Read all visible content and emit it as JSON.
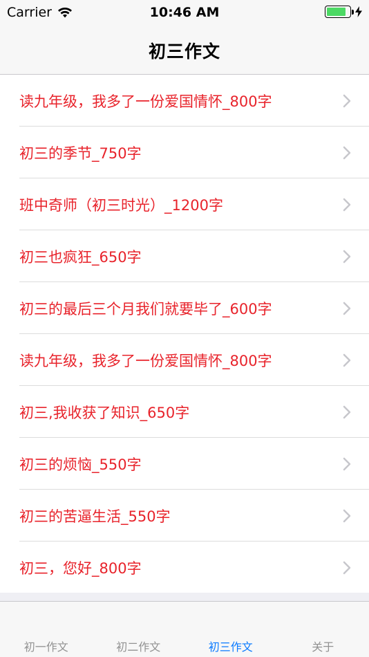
{
  "status_bar": {
    "carrier": "Carrier",
    "time": "10:46 AM",
    "battery_level": 0.85,
    "wifi_icon": "wifi-icon",
    "charging_icon": "bolt-icon"
  },
  "nav": {
    "title": "初三作文"
  },
  "list": {
    "items": [
      {
        "label": "读九年级，我多了一份爱国情怀_800字"
      },
      {
        "label": "初三的季节_750字"
      },
      {
        "label": "班中奇师（初三时光）_1200字"
      },
      {
        "label": "初三也疯狂_650字"
      },
      {
        "label": "初三的最后三个月我们就要毕了_600字"
      },
      {
        "label": "读九年级，我多了一份爱国情怀_800字"
      },
      {
        "label": "初三,我收获了知识_650字"
      },
      {
        "label": "初三的烦恼_550字"
      },
      {
        "label": "初三的苦逼生活_550字"
      },
      {
        "label": "初三，您好_800字"
      }
    ],
    "chevron_icon": "chevron-right-icon",
    "text_color": "#e8232b"
  },
  "tab_bar": {
    "tabs": [
      {
        "label": "初一作文",
        "active": false
      },
      {
        "label": "初二作文",
        "active": false
      },
      {
        "label": "初三作文",
        "active": true
      },
      {
        "label": "关于",
        "active": false
      }
    ],
    "active_color": "#0a7aff",
    "inactive_color": "#929292"
  }
}
